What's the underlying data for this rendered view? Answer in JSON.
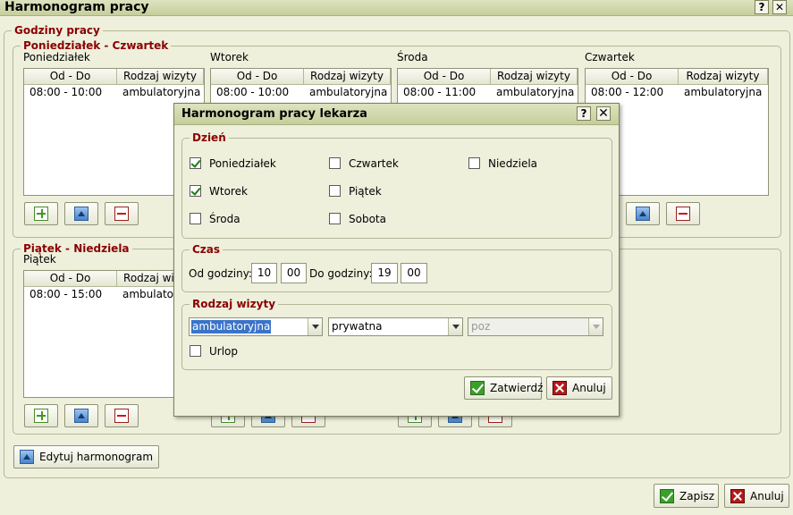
{
  "window": {
    "title": "Harmonogram pracy",
    "help_label": "?",
    "close_label": "✕"
  },
  "working_hours": {
    "legend": "Godziny pracy",
    "group1": {
      "legend": "Poniedziałek - Czwartek",
      "days": [
        {
          "label": "Poniedziałek",
          "rows": [
            {
              "time": "08:00 - 10:00",
              "type": "ambulatoryjna"
            }
          ]
        },
        {
          "label": "Wtorek",
          "rows": [
            {
              "time": "08:00 - 10:00",
              "type": "ambulatoryjna"
            }
          ]
        },
        {
          "label": "Środa",
          "rows": [
            {
              "time": "08:00 - 11:00",
              "type": "ambulatoryjna"
            }
          ]
        },
        {
          "label": "Czwartek",
          "rows": [
            {
              "time": "08:00 - 12:00",
              "type": "ambulatoryjna"
            }
          ]
        }
      ]
    },
    "group2": {
      "legend": "Piątek - Niedziela",
      "days": [
        {
          "label": "Piątek",
          "rows": [
            {
              "time": "08:00 - 15:00",
              "type": "ambulatoryjna"
            }
          ]
        }
      ]
    },
    "columns": {
      "time": "Od - Do",
      "type": "Rodzaj wizyty"
    },
    "edit_button": "Edytuj harmonogram"
  },
  "footer": {
    "save": "Zapisz",
    "cancel": "Anuluj"
  },
  "dialog": {
    "title": "Harmonogram pracy lekarza",
    "help_label": "?",
    "close_label": "✕",
    "day_section": {
      "legend": "Dzień",
      "days": [
        {
          "label": "Poniedziałek",
          "checked": true
        },
        {
          "label": "Wtorek",
          "checked": true
        },
        {
          "label": "Środa",
          "checked": false
        },
        {
          "label": "Czwartek",
          "checked": false
        },
        {
          "label": "Piątek",
          "checked": false
        },
        {
          "label": "Sobota",
          "checked": false
        },
        {
          "label": "Niedziela",
          "checked": false
        }
      ]
    },
    "time_section": {
      "legend": "Czas",
      "from_label": "Od godziny:",
      "from_hour": "10",
      "from_minute": "00",
      "to_label": "Do godziny:",
      "to_hour": "19",
      "to_minute": "00"
    },
    "visit_section": {
      "legend": "Rodzaj wizyty",
      "select1": "ambulatoryjna",
      "select2": "prywatna",
      "select3": "poz",
      "leave_label": "Urlop",
      "leave_checked": false
    },
    "confirm": "Zatwierdź",
    "cancel": "Anuluj"
  }
}
